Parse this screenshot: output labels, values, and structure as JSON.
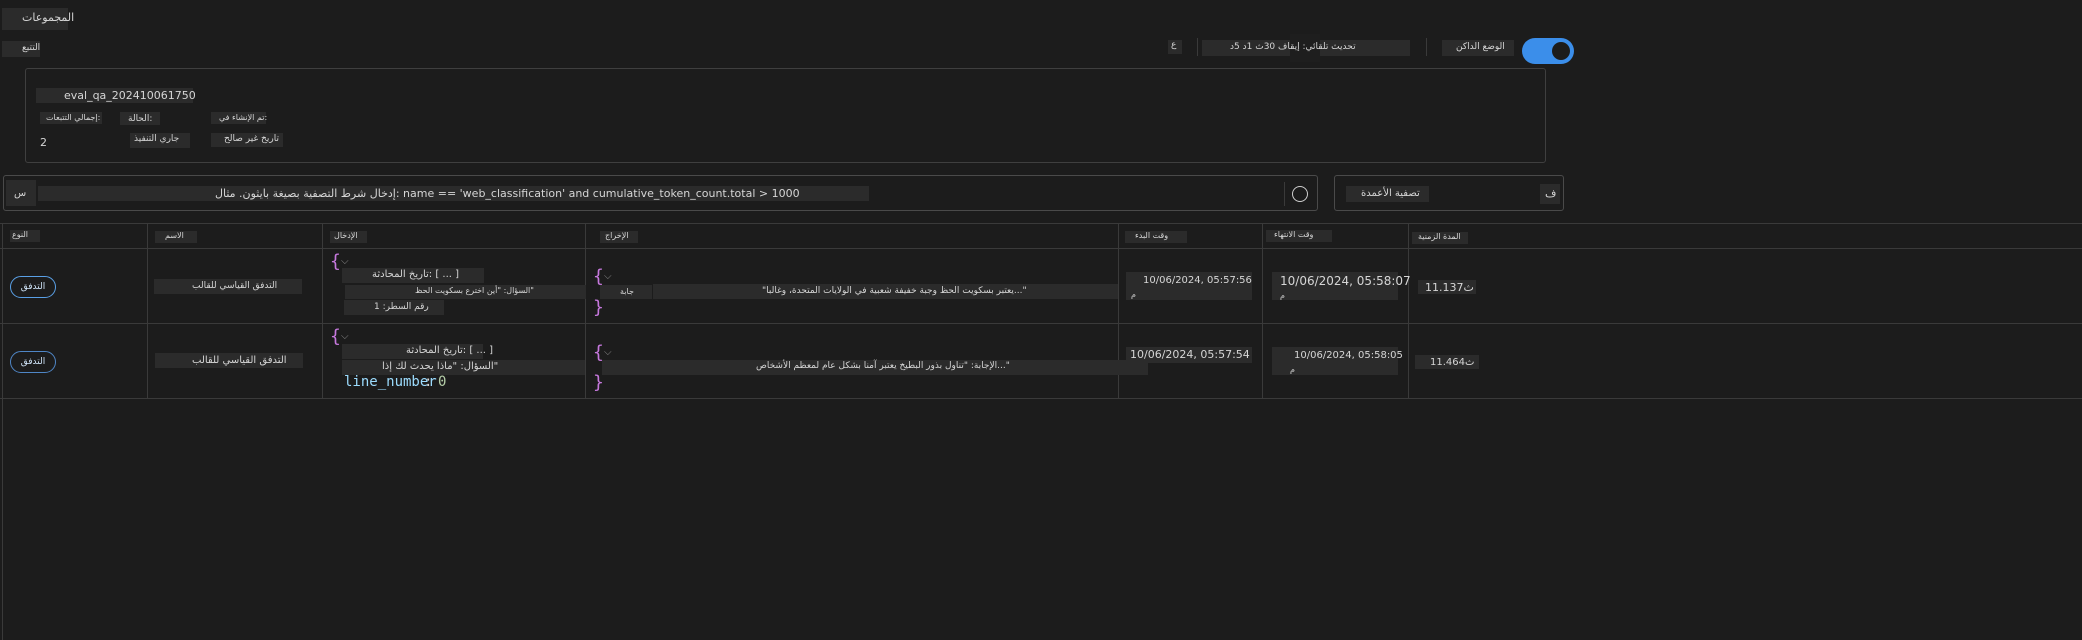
{
  "header": {
    "title": "المجموعات",
    "trace_label": "التتبع"
  },
  "toolbar": {
    "dark_mode_label": "الوضع الداكن",
    "auto_refresh_label": "تحديث تلقائي: إيقاف 30ث 1د 5د",
    "refresh_glyph": "ع"
  },
  "run_card": {
    "run_name": "eval_qa_202410061750",
    "total_traces_label": "إجمالي التتبعات:",
    "total_traces_value": "2",
    "status_label": "الحالة:",
    "status_value": "جاري التنفيذ",
    "created_label": "تم الإنشاء في:",
    "created_value": "تاريخ غير صالح"
  },
  "filter": {
    "prefix": "س",
    "placeholder": "إدخال شرط التصفية بصيغة بايثون. مثال: name == 'web_classification' and cumulative_token_count.total > 1000",
    "column_filter_label": "تصفية الأعمدة",
    "column_filter_prefix": "ف"
  },
  "table": {
    "columns": {
      "type": "النوع",
      "name": "الاسم",
      "input": "الإدخال",
      "output": "الإخراج",
      "start_time": "وقت البدء",
      "end_time": "وقت الانتهاء",
      "duration": "المدة الزمنية"
    },
    "rows": [
      {
        "type": "التدفق",
        "name": "التدفق القياسي للقالب",
        "input_line1": "تاريخ المحادثة: [ ... ]",
        "input_line2": "السؤال: \"أين اخترع بسكويت الحظ\"",
        "input_line3": "رقم السطر: 1",
        "output_key": "جابة",
        "output_value": "\"يعتبر بسكويت الحظ وجبة خفيفة شعبية في الولايات المتحدة، وغالبا...\"",
        "start": "10/06/2024, 05:57:56",
        "start_suffix": "م",
        "end": "10/06/2024, 05:58:07",
        "end_suffix": "م",
        "duration": "11.137ث"
      },
      {
        "type": "التدفق",
        "name": "التدفق القياسي للقالب",
        "input_line1": "تاريخ المحادثة: [ ... ]",
        "input_line2": "السؤال: \"ماذا يحدث لك إذا\"",
        "input_line3_key": "line_number",
        "input_line3_value": "0",
        "output_value": "الإجابة: \"تناول بذور البطيخ يعتبر آمنا بشكل عام لمعظم الأشخاص...\"",
        "start": "10/06/2024, 05:57:54",
        "end": "10/06/2024, 05:58:05",
        "end_suffix": "م",
        "duration": "11.464ث"
      }
    ]
  }
}
